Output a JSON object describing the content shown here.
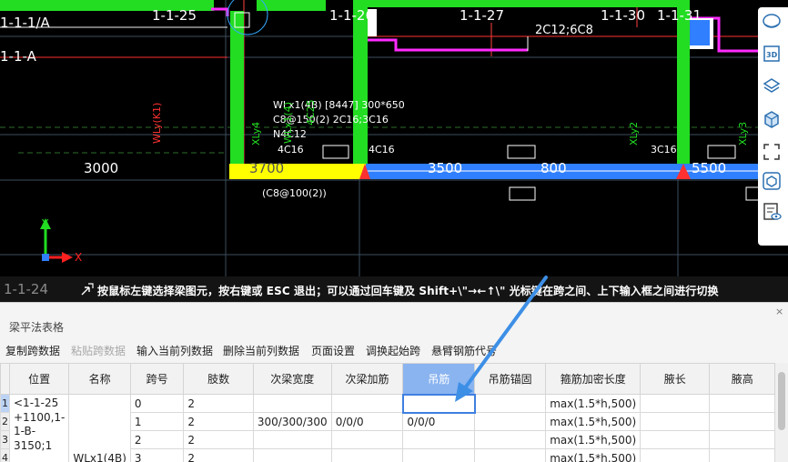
{
  "cad": {
    "grid_labels": [
      "1-1-25",
      "1-1-26",
      "1-1-27",
      "1-1-30",
      "1-1-31"
    ],
    "axis_labels_left": [
      "1-1-1/A",
      "1-1-A"
    ],
    "bottom_grid_label": "1-1-24",
    "span_dims": [
      "3000",
      "3700",
      "3500",
      "800",
      "5500"
    ],
    "beam_annotation": [
      "WLx1(4B) [8447] 300*650",
      "C8@150(2) 2C16;3C16",
      "N4C12",
      "4C16",
      "4C16"
    ],
    "top_note": "2C12;6C8",
    "stirrup_note": "(C8@100(2))",
    "rebar_3c16": "3C16",
    "vertical_beams": [
      "WLy(K1)",
      "XLy4",
      "WLx1(4)",
      "4C25",
      "XLy2",
      "XLy3"
    ],
    "axis_x": "X",
    "axis_y": "Y"
  },
  "toolbar_right": {
    "icons": [
      "view-cube-icon",
      "3d-icon",
      "layer-stack-icon",
      "box-icon",
      "fullscreen-icon",
      "component-icon",
      "sheet-eye-icon"
    ],
    "label_3d": "3D"
  },
  "hint": {
    "grid_ghost": "1-1-24",
    "text": "按鼠标左键选择梁图元，按右键或 ESC 退出；可以通过回车键及 Shift+\\\"→←↑\\\" 光标键在跨之间、上下输入框之间进行切换"
  },
  "panel": {
    "title": "梁平法表格",
    "close": "×",
    "toolbar": [
      {
        "label": "复制跨数据",
        "enabled": true
      },
      {
        "label": "粘贴跨数据",
        "enabled": false
      },
      {
        "label": "输入当前列数据",
        "enabled": true
      },
      {
        "label": "删除当前列数据",
        "enabled": true
      },
      {
        "label": "页面设置",
        "enabled": true
      },
      {
        "label": "调换起始跨",
        "enabled": true
      },
      {
        "label": "悬臂钢筋代号",
        "enabled": true
      }
    ],
    "table": {
      "headers": [
        "位置",
        "名称",
        "跨号",
        "肢数",
        "次梁宽度",
        "次梁加筋",
        "吊筋",
        "吊筋锚固",
        "箍筋加密长度",
        "腋长",
        "腋高"
      ],
      "selected_header": "吊筋",
      "position": "<1-1-25 +1100,1-1-B-3150;1",
      "name": "WLx1(4B)",
      "rows": [
        {
          "rn": "1",
          "span": "0",
          "legs": "2",
          "sec_width": "",
          "sec_add": "",
          "hanger": "",
          "anchor": "",
          "dense": "max(1.5*h,500)",
          "haunch_len": "",
          "haunch_h": ""
        },
        {
          "rn": "2",
          "span": "1",
          "legs": "2",
          "sec_width": "300/300/300",
          "sec_add": "0/0/0",
          "hanger": "0/0/0",
          "anchor": "",
          "dense": "max(1.5*h,500)",
          "haunch_len": "",
          "haunch_h": ""
        },
        {
          "rn": "3",
          "span": "2",
          "legs": "2",
          "sec_width": "",
          "sec_add": "",
          "hanger": "",
          "anchor": "",
          "dense": "max(1.5*h,500)",
          "haunch_len": "",
          "haunch_h": ""
        },
        {
          "rn": "4",
          "span": "3",
          "legs": "2",
          "sec_width": "",
          "sec_add": "",
          "hanger": "",
          "anchor": "",
          "dense": "max(1.5*h,500)",
          "haunch_len": "",
          "haunch_h": ""
        }
      ]
    }
  },
  "colors": {
    "beam_green": "#22dd22",
    "beam_blue": "#2f7fff",
    "beam_yellow": "#ffff00",
    "wall_magenta": "#ff2bff",
    "select_blue": "#8ab4f0",
    "callout": "#3d8fe6"
  }
}
